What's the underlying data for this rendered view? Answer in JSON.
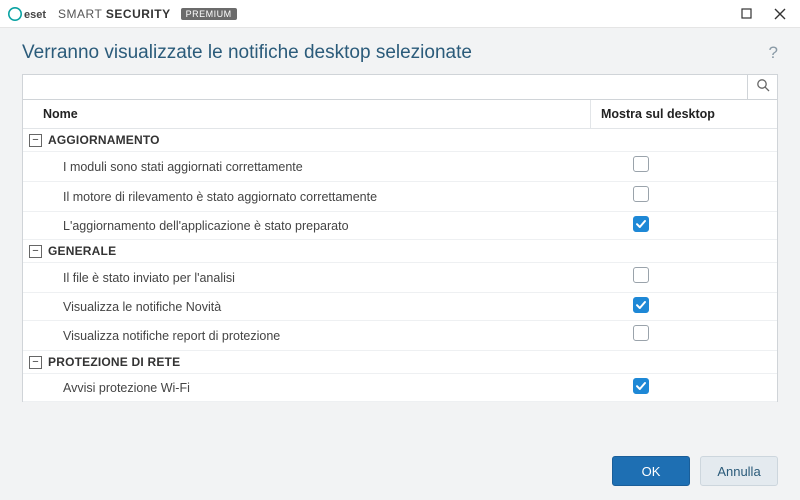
{
  "brand": {
    "name_light": "SMART",
    "name_bold": "SECURITY",
    "edition": "PREMIUM",
    "company": "eset"
  },
  "header": {
    "title": "Verranno visualizzate le notifiche desktop selezionate"
  },
  "search": {
    "value": "",
    "placeholder": ""
  },
  "columns": {
    "name": "Nome",
    "show": "Mostra sul desktop"
  },
  "groups": [
    {
      "label": "AGGIORNAMENTO",
      "expanded": true,
      "items": [
        {
          "name": "I moduli sono stati aggiornati correttamente",
          "checked": false
        },
        {
          "name": "Il motore di rilevamento è stato aggiornato correttamente",
          "checked": false
        },
        {
          "name": "L'aggiornamento dell'applicazione è stato preparato",
          "checked": true
        }
      ]
    },
    {
      "label": "GENERALE",
      "expanded": true,
      "items": [
        {
          "name": "Il file è stato inviato per l'analisi",
          "checked": false
        },
        {
          "name": "Visualizza le notifiche Novità",
          "checked": true
        },
        {
          "name": "Visualizza notifiche report di protezione",
          "checked": false
        }
      ]
    },
    {
      "label": "PROTEZIONE DI RETE",
      "expanded": true,
      "items": [
        {
          "name": "Avvisi protezione Wi-Fi",
          "checked": true
        }
      ]
    }
  ],
  "buttons": {
    "ok": "OK",
    "cancel": "Annulla"
  }
}
